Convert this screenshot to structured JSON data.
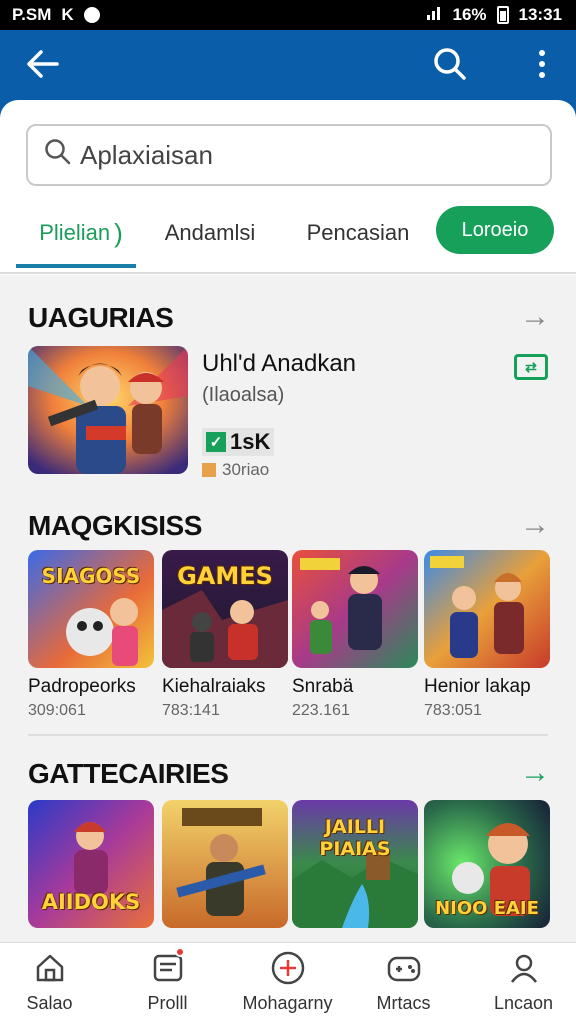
{
  "status_bar": {
    "left_text": "P.SM",
    "left_icon2": "K",
    "right_pct": "16%",
    "time": "13:31"
  },
  "search": {
    "placeholder": "Aplaxiaisan"
  },
  "tabs": [
    {
      "label": "Plielian",
      "active": true
    },
    {
      "label": "Andamlsi",
      "active": false
    },
    {
      "label": "Pencasian",
      "active": false
    },
    {
      "label": "Loroeio",
      "active": false
    }
  ],
  "section1": {
    "title": "UAGURIAS",
    "featured": {
      "title": "Uhl'd Anadkan",
      "subtitle": "(Ilaoalsa)",
      "badge": "1sK",
      "meta": "30riao"
    }
  },
  "section2": {
    "title": "MAQGKISISS",
    "cards": [
      {
        "name": "Padropeorks",
        "meta": "309:061",
        "thumb_label": "SIAGOSS"
      },
      {
        "name": "Kiehalraiaks",
        "meta": "783:141",
        "thumb_label": "GAMES"
      },
      {
        "name": "Snrabä",
        "meta": "223.161",
        "thumb_label": ""
      },
      {
        "name": "Henior lakap",
        "meta": "783:051",
        "thumb_label": ""
      }
    ]
  },
  "section3": {
    "title": "GATTECAIRIES",
    "cards": [
      {
        "thumb_label": "AIIDOKS"
      },
      {
        "thumb_label": ""
      },
      {
        "thumb_label": "JAILLI PIAIAS"
      },
      {
        "thumb_label": "NIOO EAIE"
      }
    ]
  },
  "bottom_nav": [
    {
      "label": "Salao",
      "icon": "home-icon"
    },
    {
      "label": "Prolll",
      "icon": "inbox-icon"
    },
    {
      "label": "Mohagarny",
      "icon": "plus-circle-icon"
    },
    {
      "label": "Mrtacs",
      "icon": "gamepad-icon"
    },
    {
      "label": "Lncaon",
      "icon": "person-icon"
    }
  ],
  "colors": {
    "app_bar": "#0a5da8",
    "accent_green": "#16a05a",
    "tab_underline": "#1a7fa8"
  }
}
